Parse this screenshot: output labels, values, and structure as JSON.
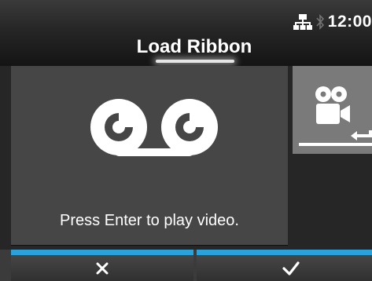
{
  "status_bar": {
    "time": "12:00",
    "icons": [
      "network-icon",
      "bluetooth-icon"
    ]
  },
  "header": {
    "title": "Load Ribbon"
  },
  "video_panel": {
    "icon": "ribbon-icon",
    "prompt": "Press Enter to play video."
  },
  "side_tab": {
    "icons": [
      "video-camera-icon",
      "enter-arrow-icon"
    ]
  },
  "footer": {
    "left_key_icon": "close-icon",
    "right_key_icon": "check-icon"
  },
  "colors": {
    "accent": "#29a3d9",
    "panel": "#464646",
    "side_tab": "#7a7a7a",
    "background": "#262626"
  }
}
